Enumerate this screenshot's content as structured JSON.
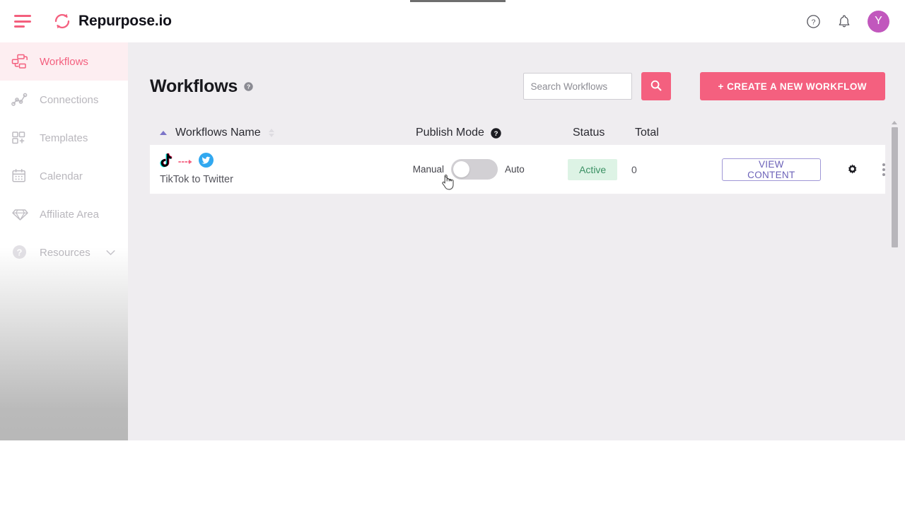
{
  "app": {
    "brand_name": "Repurpose.io",
    "accent_pink": "#f4607f",
    "accent_purple": "#6b61b8",
    "avatar_bg": "#c157bd"
  },
  "topbar": {
    "menu_icon": "hamburger-icon",
    "logo_icon": "repurpose-refresh-logo",
    "help_icon": "help-circle-icon",
    "notifications_icon": "bell-icon",
    "avatar_initial": "Y"
  },
  "sidebar": {
    "items": [
      {
        "label": "Workflows",
        "icon": "workflows-icon",
        "active": true
      },
      {
        "label": "Connections",
        "icon": "connections-icon",
        "active": false
      },
      {
        "label": "Templates",
        "icon": "templates-icon",
        "active": false
      },
      {
        "label": "Calendar",
        "icon": "calendar-icon",
        "active": false
      },
      {
        "label": "Affiliate Area",
        "icon": "diamond-icon",
        "active": false
      },
      {
        "label": "Resources",
        "icon": "question-circle-icon",
        "active": false,
        "chevron": "chevron-down-icon"
      }
    ]
  },
  "main": {
    "page_title": "Workflows",
    "title_help_icon": "help-circle-icon",
    "search": {
      "placeholder": "Search Workflows",
      "value": "",
      "button_icon": "search-icon"
    },
    "create_button_label": "+ CREATE A NEW WORKFLOW",
    "table": {
      "headers": {
        "name": "Workflows Name",
        "publish_mode": "Publish Mode",
        "publish_mode_help_icon": "help-circle-filled-icon",
        "status": "Status",
        "total": "Total"
      },
      "sort": {
        "active_column": "Workflows Name",
        "direction": "asc",
        "active_indicator_color": "#7c74c8"
      },
      "rows": [
        {
          "source_icon": "tiktok-icon",
          "flow_icon": "dotted-arrow-icon",
          "target_icon": "twitter-icon",
          "name": "TikTok to Twitter",
          "publish_mode": {
            "left_label": "Manual",
            "right_label": "Auto",
            "toggle_state": "off"
          },
          "status": "Active",
          "total": "0",
          "view_button_label": "VIEW CONTENT",
          "settings_icon": "gear-icon",
          "more_icon": "kebab-menu-icon"
        }
      ]
    },
    "scrollbar": {
      "up_arrow_icon": "scroll-up-arrow-icon",
      "thumb": "scrollbar-thumb"
    }
  }
}
